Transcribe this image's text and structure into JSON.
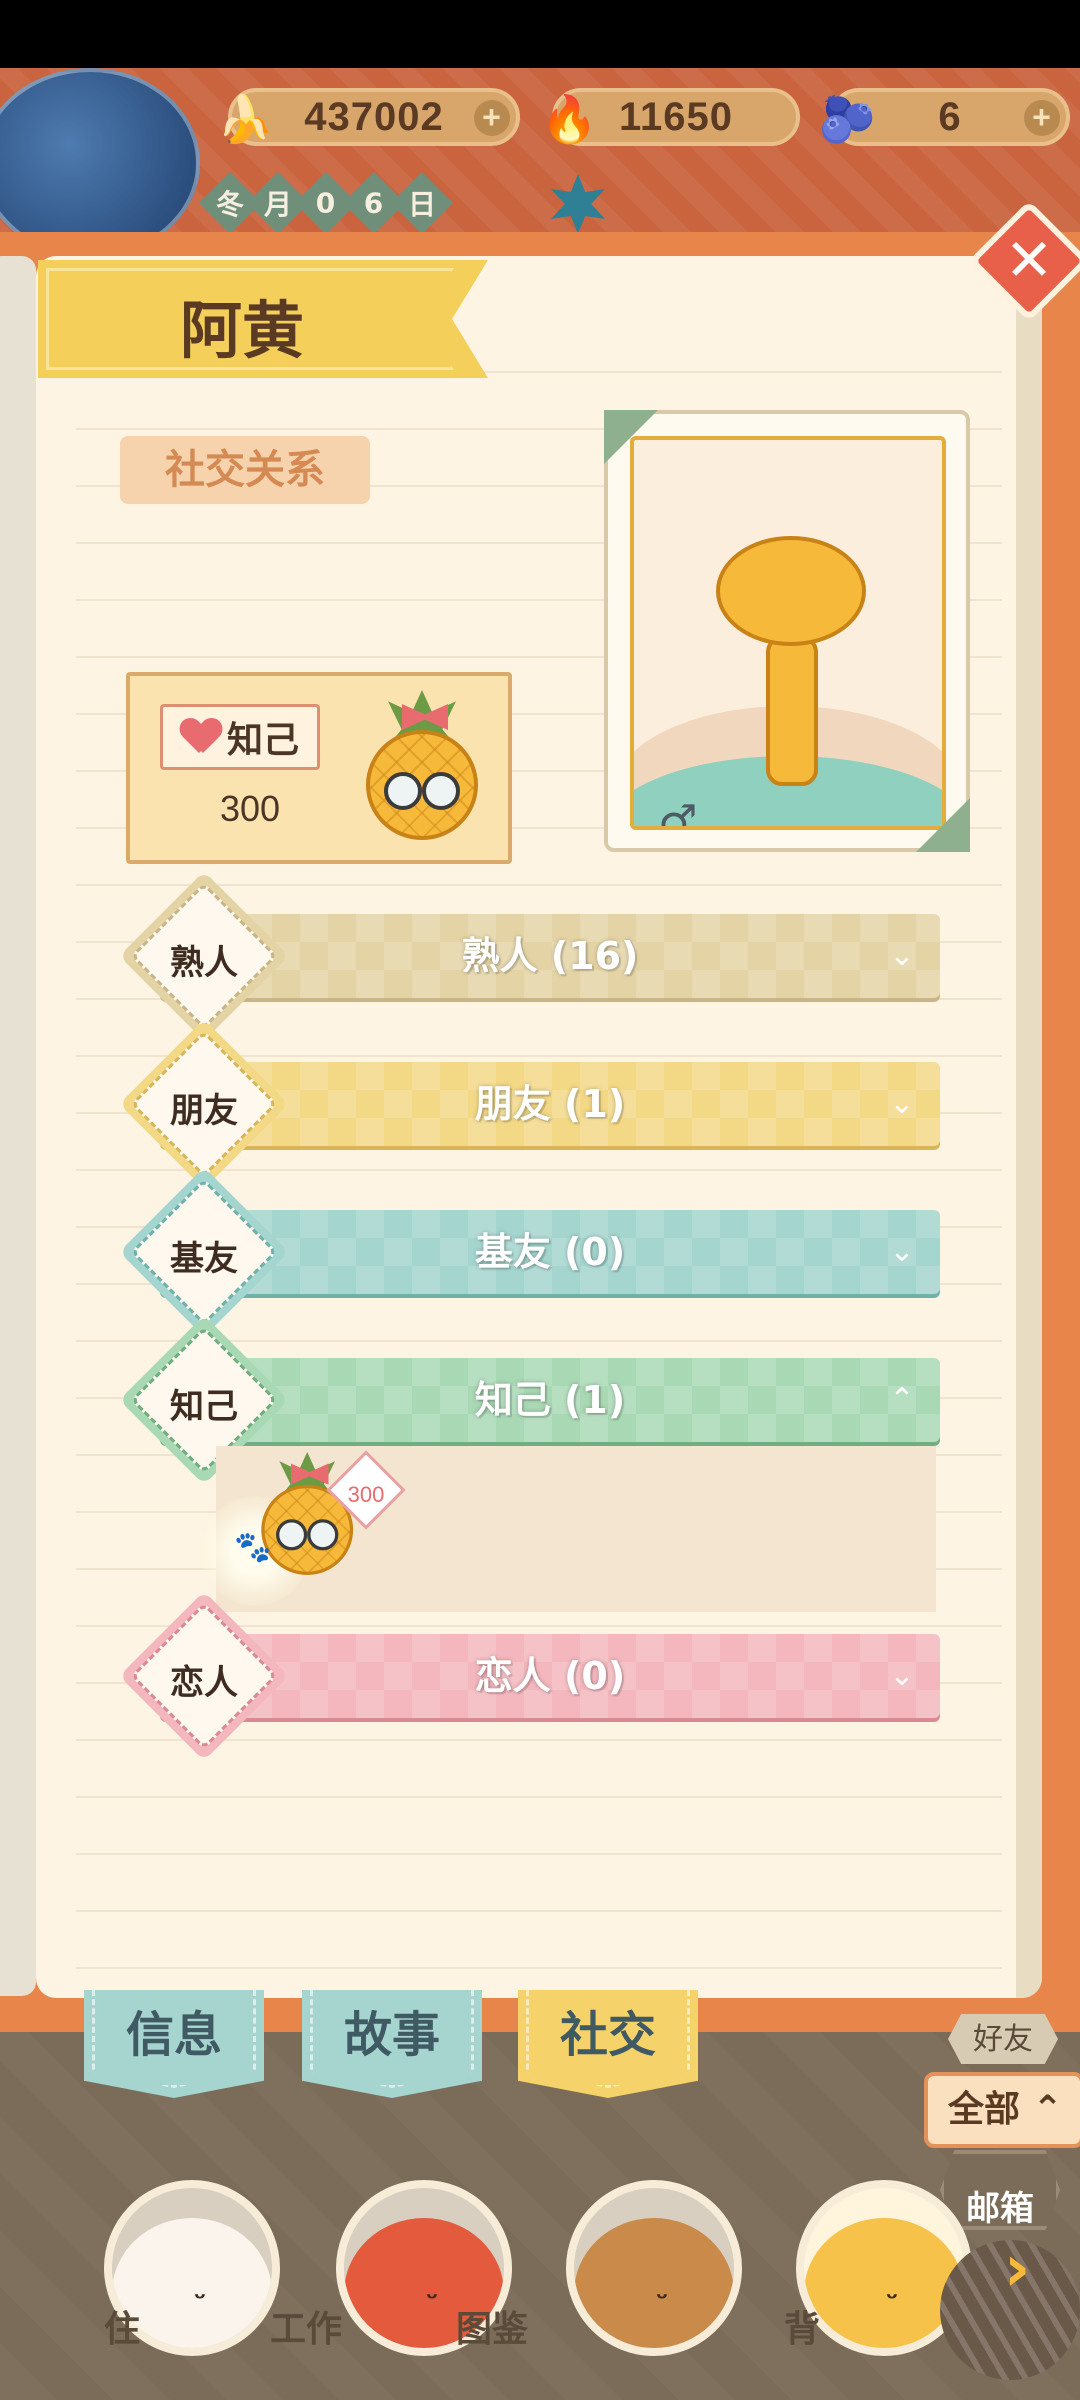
{
  "resources": {
    "bananas": "437002",
    "fire": "11650",
    "blue_bananas": "6",
    "banana_icon": "banana-icon",
    "fire_icon": "fire-icon",
    "blue_banana_icon": "blue-banana-icon"
  },
  "date": {
    "chars": [
      "冬",
      "月",
      "0",
      "6",
      "日"
    ]
  },
  "character": {
    "name": "阿黄",
    "gender_symbol": "♂"
  },
  "section": {
    "title": "社交关系"
  },
  "top_relation": {
    "tag": "知己",
    "value": "300"
  },
  "categories": [
    {
      "diamond": "熟人",
      "label": "熟人 (16)",
      "color": "#e4d3a4",
      "border": "#c9b686",
      "expanded": false
    },
    {
      "diamond": "朋友",
      "label": "朋友 (1)",
      "color": "#f3d886",
      "border": "#d8b558",
      "expanded": false
    },
    {
      "diamond": "基友",
      "label": "基友 (0)",
      "color": "#a4d5cf",
      "border": "#6fb2ab",
      "expanded": false
    },
    {
      "diamond": "知己",
      "label": "知己 (1)",
      "color": "#a9d8b4",
      "border": "#6fae7e",
      "expanded": true
    },
    {
      "diamond": "恋人",
      "label": "恋人 (0)",
      "color": "#f3b7bd",
      "border": "#d98a93",
      "expanded": false
    }
  ],
  "expanded_member": {
    "score": "300"
  },
  "tabs": [
    {
      "label": "信息",
      "color": "#a6d4cf"
    },
    {
      "label": "故事",
      "color": "#a6d4cf"
    },
    {
      "label": "社交",
      "color": "#f5d36a"
    }
  ],
  "bottom_nav": {
    "labels": [
      "住",
      "工作",
      "图鉴",
      "背"
    ],
    "friends_label": "好友",
    "all_label": "全部 ⌃",
    "mail_label": "邮箱",
    "next_arrow": "›"
  }
}
